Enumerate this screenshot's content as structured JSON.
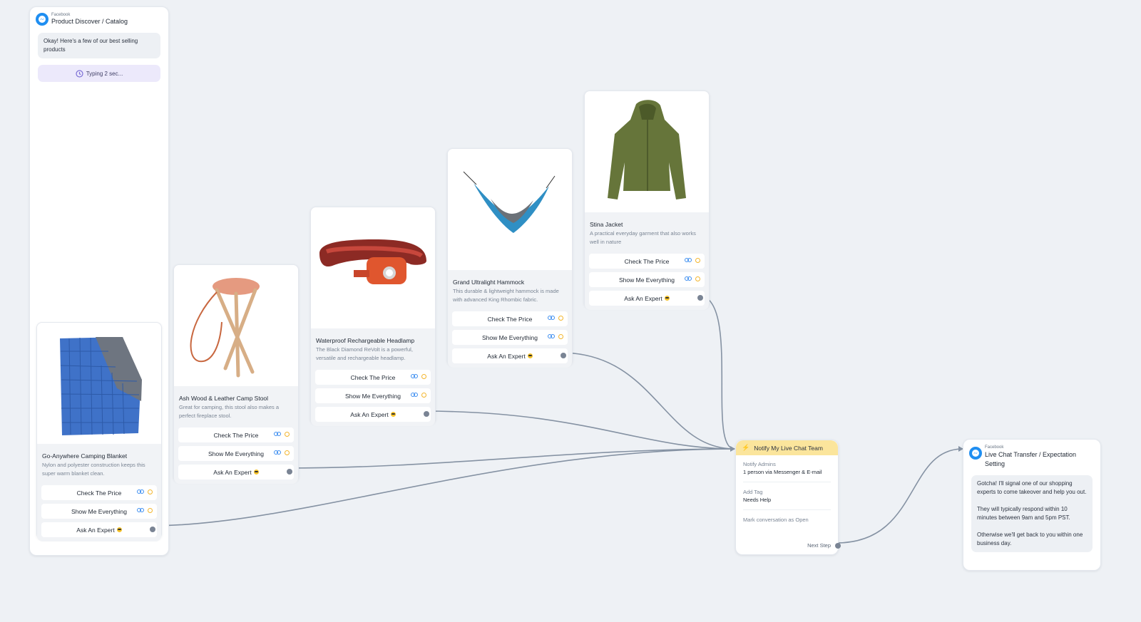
{
  "canvas": {
    "background": "#eef1f5",
    "wire_color": "#8592a3",
    "accent_yellow": "#f3b52c",
    "messenger_blue": "#1f8ef1"
  },
  "start_node": {
    "platform": "Facebook",
    "title": "Product Discover / Catalog",
    "message": "Okay! Here's a few of our best selling products",
    "typing": "Typing 2 sec...",
    "icon": "messenger-icon",
    "typing_icon": "clock-icon"
  },
  "products": [
    {
      "title": "Go-Anywhere Camping Blanket",
      "desc": "Nylon and polyester construction keeps this super warm blanket clean.",
      "image": "blanket-image",
      "buttons": [
        "Check The Price",
        "Show Me Everything",
        "Ask An Expert"
      ]
    },
    {
      "title": "Ash Wood & Leather Camp Stool",
      "desc": "Great for camping, this stool also makes a perfect fireplace stool.",
      "image": "stool-image",
      "buttons": [
        "Check The Price",
        "Show Me Everything",
        "Ask An Expert"
      ]
    },
    {
      "title": "Waterproof Rechargeable Headlamp",
      "desc": "The Black Diamond ReVolt is a powerful, versatile and rechargeable headlamp.",
      "image": "headlamp-image",
      "buttons": [
        "Check The Price",
        "Show Me Everything",
        "Ask An Expert"
      ]
    },
    {
      "title": "Grand Ultralight Hammock",
      "desc": "This durable & lightweight hammock is made with advanced King Rhombic fabric.",
      "image": "hammock-image",
      "buttons": [
        "Check The Price",
        "Show Me Everything",
        "Ask An Expert"
      ]
    },
    {
      "title": "Stina Jacket",
      "desc": "A practical everyday garment that also works well in nature",
      "image": "jacket-image",
      "buttons": [
        "Check The Price",
        "Show Me Everything",
        "Ask An Expert"
      ]
    }
  ],
  "notify_node": {
    "title": "Notify My Live Chat Team",
    "notify_label": "Notify Admins",
    "notify_value": "1 person via Messenger & E-mail",
    "tag_label": "Add Tag",
    "tag_value": "Needs Help",
    "mark": "Mark conversation as Open",
    "next": "Next Step"
  },
  "transfer_node": {
    "platform": "Facebook",
    "title": "Live Chat Transfer / Expectation Setting",
    "p1": "Gotcha! I'll signal one of our shopping experts to come takeover and help you out.",
    "p2": "They will typically respond within 10 minutes between 9am and 5pm PST.",
    "p3": "Otherwise we'll get back to you within one business day."
  }
}
